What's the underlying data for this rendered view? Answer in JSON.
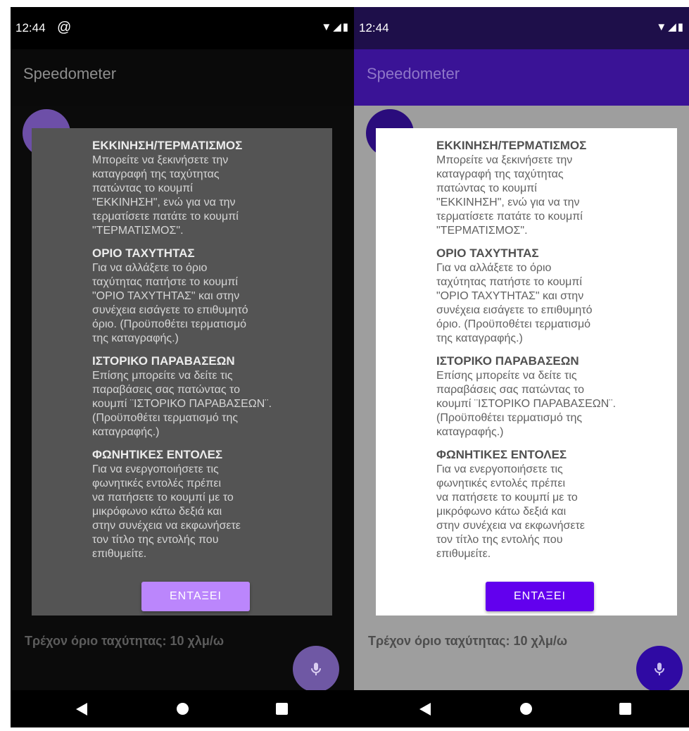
{
  "status": {
    "time": "12:44"
  },
  "app": {
    "title": "Speedometer"
  },
  "dialog": {
    "sections": [
      {
        "title": "ΕΚΚΙΝΗΣΗ/ΤΕΡΜΑΤΙΣΜΟΣ",
        "text": "Μπορείτε να ξεκινήσετε την\nκαταγραφή της ταχύτητας\nπατώντας το κουμπί\n\"ΕΚΚΙΝΗΣΗ\", ενώ για να την\nτερματίσετε πατάτε το κουμπί\n\"ΤΕΡΜΑΤΙΣΜΟΣ\"."
      },
      {
        "title": "ΟΡΙΟ ΤΑΧΥΤΗΤΑΣ",
        "text": "Για να αλλάξετε το όριο\nταχύτητας πατήστε το κουμπί\n\"ΟΡΙΟ ΤΑΧΥΤΗΤΑΣ\" και στην\nσυνέχεια εισάγετε το επιθυμητό\nόριο. (Προϋποθέτει τερματισμό\nτης καταγραφής.)"
      },
      {
        "title": "ΙΣΤΟΡΙΚΟ ΠΑΡΑΒΑΣΕΩΝ",
        "text": "Επίσης μπορείτε να δείτε τις\nπαραβάσεις σας πατώντας το\nκουμπί ¨ΙΣΤΟΡΙΚΟ ΠΑΡΑΒΑΣΕΩΝ¨.\n(Προϋποθέτει τερματισμό της\nκαταγραφής.)"
      },
      {
        "title": "ΦΩΝΗΤΙΚΕΣ ΕΝΤΟΛΕΣ",
        "text": "Για να ενεργοποιήσετε τις\nφωνητικές εντολές πρέπει\nνα πατήσετε το κουμπί με το\nμικρόφωνο κάτω δεξιά και\nστην συνέχεια να εκφωνήσετε\nτον τίτλο της εντολής που\nεπιθυμείτε."
      }
    ],
    "ok_label": "ΕΝΤΑΞΕΙ"
  },
  "speed_limit_text": "Τρέχον όριο ταχύτητας: 10 χλμ/ω",
  "icons": {
    "status_extra": "at-sign-icon",
    "wifi": "wifi-icon",
    "signal": "signal-icon",
    "battery": "battery-icon",
    "mic": "microphone-icon",
    "back": "back-triangle-icon",
    "home": "home-circle-icon",
    "recent": "recent-square-icon"
  },
  "themes": {
    "left": {
      "name": "dark",
      "accent": "#bb86fc"
    },
    "right": {
      "name": "light",
      "accent": "#6200ee"
    }
  }
}
